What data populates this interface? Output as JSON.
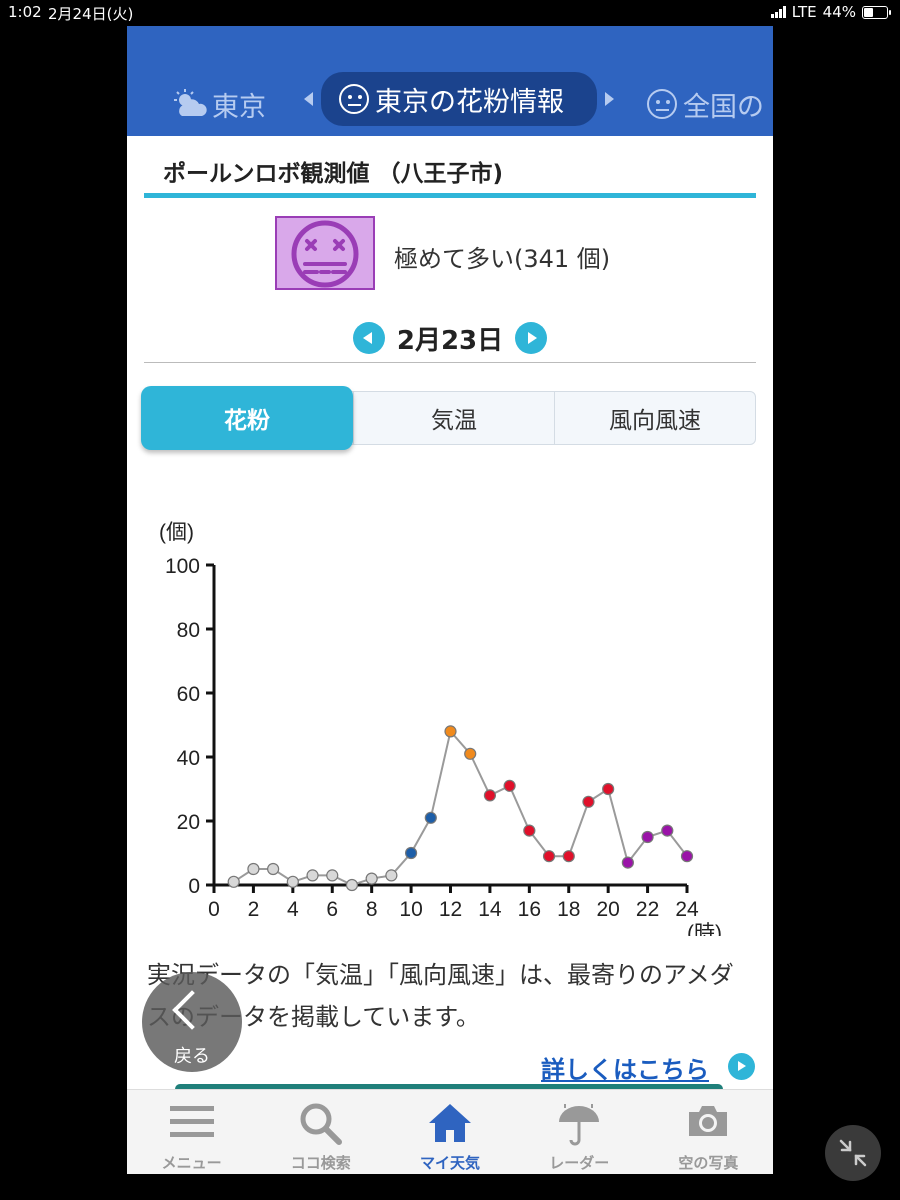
{
  "status_bar": {
    "time": "1:02",
    "date": "2月24日(火)",
    "network": "LTE",
    "battery": "44%",
    "battery_level": 0.44
  },
  "header": {
    "nav_left": "東京",
    "nav_current": "東京の花粉情報",
    "nav_right": "全国の"
  },
  "station": {
    "title": "ポールンロボ観測値 （八王子市)"
  },
  "level": {
    "text": "極めて多い(341 個)",
    "color": "#d9a8ea"
  },
  "date": {
    "label": "2月23日"
  },
  "tabs": [
    {
      "label": "花粉",
      "active": true
    },
    {
      "label": "気温",
      "active": false
    },
    {
      "label": "風向風速",
      "active": false
    }
  ],
  "chart_data": {
    "type": "line",
    "ylabel": "(個)",
    "xlabel": "(時)",
    "ylim": [
      0,
      100
    ],
    "xlim": [
      0,
      24
    ],
    "yticks": [
      0,
      20,
      40,
      60,
      80,
      100
    ],
    "xticks": [
      0,
      2,
      4,
      6,
      8,
      10,
      12,
      14,
      16,
      18,
      20,
      22,
      24
    ],
    "grid": false,
    "series": [
      {
        "x": [
          1,
          2,
          3,
          4,
          5,
          6,
          7,
          8,
          9,
          10,
          11,
          12,
          13,
          14,
          15,
          16,
          17,
          18,
          19,
          20,
          21,
          22,
          23,
          24
        ],
        "values": [
          1,
          5,
          5,
          1,
          3,
          3,
          0,
          2,
          3,
          10,
          21,
          48,
          41,
          28,
          31,
          17,
          9,
          9,
          26,
          30,
          7,
          15,
          17,
          9
        ],
        "point_colors": [
          "#d8d8d8",
          "#d8d8d8",
          "#d8d8d8",
          "#d8d8d8",
          "#d8d8d8",
          "#d8d8d8",
          "#d8d8d8",
          "#d8d8d8",
          "#d8d8d8",
          "#1d5ea8",
          "#1d5ea8",
          "#f08a1d",
          "#f08a1d",
          "#e0102a",
          "#e0102a",
          "#e0102a",
          "#e0102a",
          "#e0102a",
          "#e0102a",
          "#e0102a",
          "#9a13a8",
          "#9a13a8",
          "#9a13a8",
          "#9a13a8"
        ]
      }
    ]
  },
  "note": "実況データの「気温」「風向風速」は、最寄りのアメダスのデータを掲載しています。",
  "more_link": "詳しくはこちら",
  "back_button": "戻る",
  "tabbar": [
    {
      "label": "メニュー",
      "icon": "menu-icon",
      "active": false
    },
    {
      "label": "ココ検索",
      "icon": "search-icon",
      "active": false
    },
    {
      "label": "マイ天気",
      "icon": "home-icon",
      "active": true
    },
    {
      "label": "レーダー",
      "icon": "umbrella-icon",
      "active": false
    },
    {
      "label": "空の写真",
      "icon": "camera-icon",
      "active": false
    }
  ]
}
